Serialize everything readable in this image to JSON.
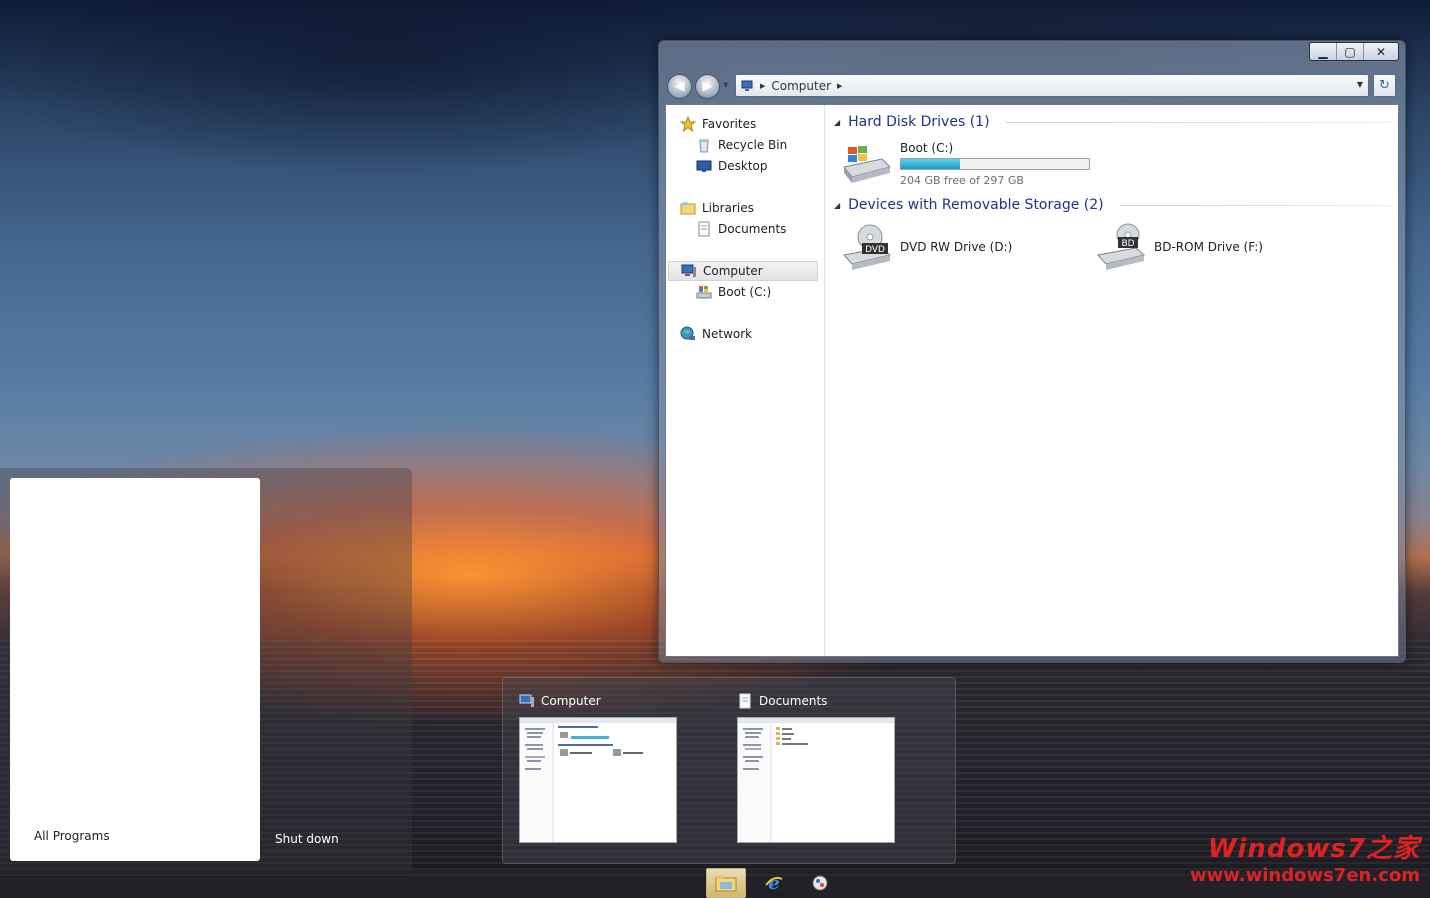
{
  "window": {
    "caption_buttons": {
      "minimize": "▁",
      "maximize": "▢",
      "close": "✕"
    },
    "address": {
      "crumbs": [
        "Computer"
      ],
      "icon": "computer-icon"
    },
    "nav_pane": [
      {
        "label": "Favorites",
        "icon": "star-icon",
        "level": 0
      },
      {
        "label": "Recycle Bin",
        "icon": "recycle-bin-icon",
        "level": 1
      },
      {
        "label": "Desktop",
        "icon": "desktop-icon",
        "level": 1
      },
      {
        "label": "Libraries",
        "icon": "libraries-icon",
        "level": 0
      },
      {
        "label": "Documents",
        "icon": "document-icon",
        "level": 1
      },
      {
        "label": "Computer",
        "icon": "computer-icon",
        "level": 0,
        "selected": true
      },
      {
        "label": "Boot (C:)",
        "icon": "drive-icon",
        "level": 1
      },
      {
        "label": "Network",
        "icon": "network-icon",
        "level": 0
      }
    ],
    "groups": {
      "hdd": {
        "title": "Hard Disk Drives (1)",
        "drive": {
          "name": "Boot (C:)",
          "free_text": "204 GB free of 297 GB",
          "used_fraction": 0.313
        }
      },
      "removable": {
        "title": "Devices with Removable Storage (2)",
        "drives": [
          {
            "name": "DVD RW Drive (D:)",
            "badge": "DVD"
          },
          {
            "name": "BD-ROM Drive (F:)",
            "badge": "BD"
          }
        ]
      }
    }
  },
  "start_menu": {
    "all_programs": "All Programs",
    "shut_down": "Shut down"
  },
  "previews": [
    {
      "title": "Computer",
      "icon": "computer-icon"
    },
    {
      "title": "Documents",
      "icon": "document-icon"
    }
  ],
  "taskbar": [
    {
      "name": "explorer",
      "icon": "folder-icon",
      "active": true
    },
    {
      "name": "internet-explorer",
      "icon": "ie-icon",
      "active": false
    },
    {
      "name": "media-center",
      "icon": "media-icon",
      "active": false
    }
  ],
  "watermark": {
    "line1": "Windows7之家",
    "line2": "www.windows7en.com"
  }
}
